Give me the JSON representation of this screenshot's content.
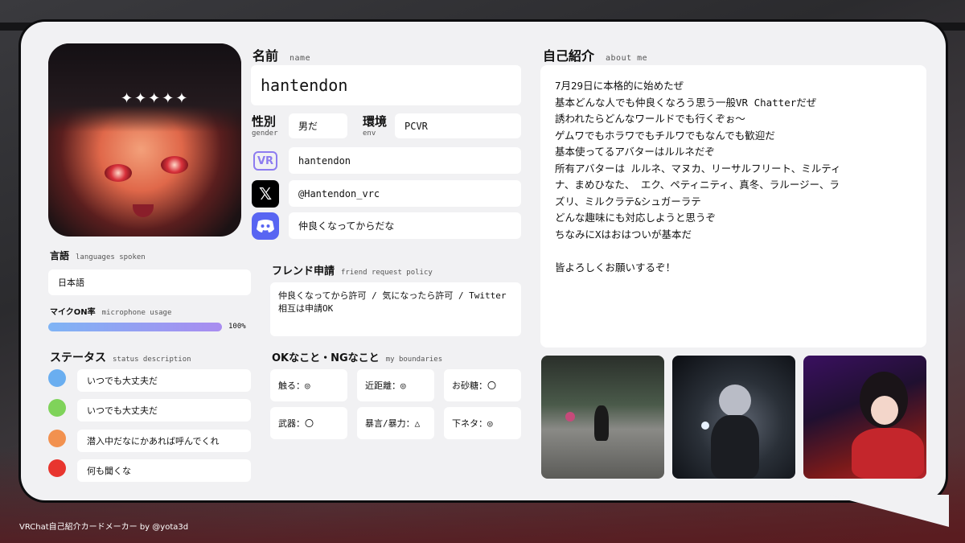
{
  "name": {
    "heading": "名前",
    "heading_en": "name",
    "value": "hantendon"
  },
  "gender": {
    "label": "性別",
    "label_en": "gender",
    "value": "男だ"
  },
  "env": {
    "label": "環境",
    "label_en": "env",
    "value": "PCVR"
  },
  "social": {
    "vrchat": {
      "icon_text": "VR",
      "icon": "vrchat-icon",
      "value": "hantendon"
    },
    "x": {
      "icon_text": "𝕏",
      "icon": "x-icon",
      "value": "@Hantendon_vrc"
    },
    "discord": {
      "icon": "discord-icon",
      "value": "仲良くなってからだな"
    }
  },
  "languages": {
    "heading": "言語",
    "heading_en": "languages spoken",
    "value": "日本語"
  },
  "mic": {
    "heading": "マイクON率",
    "heading_en": "microphone usage",
    "percent": 100,
    "percent_label": "100%"
  },
  "status": {
    "heading": "ステータス",
    "heading_en": "status description",
    "items": [
      {
        "color": "#6aaef0",
        "text": "いつでも大丈夫だ"
      },
      {
        "color": "#7fd35a",
        "text": "いつでも大丈夫だ"
      },
      {
        "color": "#f2914f",
        "text": "潜入中だなにかあれば呼んでくれ"
      },
      {
        "color": "#e8352e",
        "text": "何も聞くな"
      }
    ]
  },
  "friend_request": {
    "heading": "フレンド申請",
    "heading_en": "friend request policy",
    "value": "仲良くなってから許可 / 気になったら許可 / Twitter相互は申請OK"
  },
  "boundaries": {
    "heading": "OKなこと・NGなこと",
    "heading_en": "my boundaries",
    "items": [
      {
        "text": "触る：◎"
      },
      {
        "text": "近距離：◎"
      },
      {
        "text": "お砂糖：〇"
      },
      {
        "text": "武器：〇"
      },
      {
        "text": "暴言/暴力：△"
      },
      {
        "text": "下ネタ：◎"
      }
    ]
  },
  "about": {
    "heading": "自己紹介",
    "heading_en": "about me",
    "lines": [
      "7月29日に本格的に始めたぜ",
      "基本どんな人でも仲良くなろう思う一般VR Chatterだぜ",
      "誘われたらどんなワールドでも行くぞぉ～",
      "ゲムワでもホラワでもチルワでもなんでも歓迎だ",
      "基本使ってるアバターはルルネだぞ",
      "所有アバターは ルルネ、マヌカ、リーサルフリート、ミルティ",
      "ナ、まめひなた、 エク、ペティニティ、真冬、ラルージー、ラ",
      "ズリ、ミルクラテ&シュガーラテ",
      "どんな趣味にも対応しようと思うぞ",
      "ちなみにXはおはついが基本だ",
      "",
      "皆よろしくお願いするぞ！"
    ]
  },
  "footer": {
    "text": "VRChat自己紹介カードメーカー by @yota3d"
  }
}
